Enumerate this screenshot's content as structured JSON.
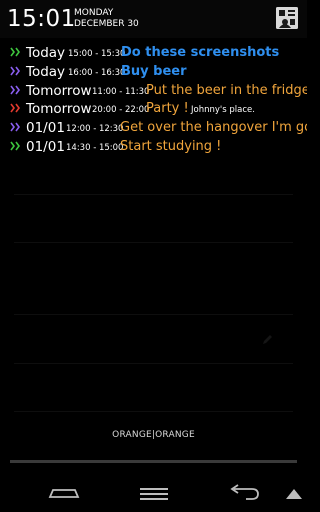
{
  "status": {
    "clock": "15:01",
    "weekday": "MONDAY",
    "date": "DECEMBER 30"
  },
  "events": [
    {
      "day": "Today",
      "time": "15:00 - 15:30",
      "title": "Do these screenshots",
      "note": "",
      "chevron_color": "#3ec63e",
      "title_color": "#2f8fef",
      "bold": true
    },
    {
      "day": "Today",
      "time": "16:00 - 16:30",
      "title": "Buy beer",
      "note": "",
      "chevron_color": "#8a5ef0",
      "title_color": "#2f8fef",
      "bold": true
    },
    {
      "day": "Tomorrow",
      "time": "11:00 - 11:30",
      "title": "Put the beer in the fridge.",
      "note": "",
      "chevron_color": "#8a5ef0",
      "title_color": "#f0a53c",
      "bold": false
    },
    {
      "day": "Tomorrow",
      "time": "20:00 - 22:00",
      "title": "Party !",
      "note": "Johnny's place.",
      "chevron_color": "#e23a2e",
      "title_color": "#f0a53c",
      "bold": false
    },
    {
      "day": "01/01",
      "time": "12:00 - 12:30",
      "title": "Get over the hangover I'm go...",
      "note": "",
      "chevron_color": "#8a5ef0",
      "title_color": "#f0a53c",
      "bold": false
    },
    {
      "day": "01/01",
      "time": "14:30 - 15:00",
      "title": "Start studying !",
      "note": "",
      "chevron_color": "#3ec63e",
      "title_color": "#f0a53c",
      "bold": false
    }
  ],
  "theme_label": "ORANGE|ORANGE",
  "icons": {
    "settings": "settings-icon",
    "back": "back-icon",
    "home": "home-icon",
    "recents": "recents-icon",
    "menu": "menu-icon"
  }
}
